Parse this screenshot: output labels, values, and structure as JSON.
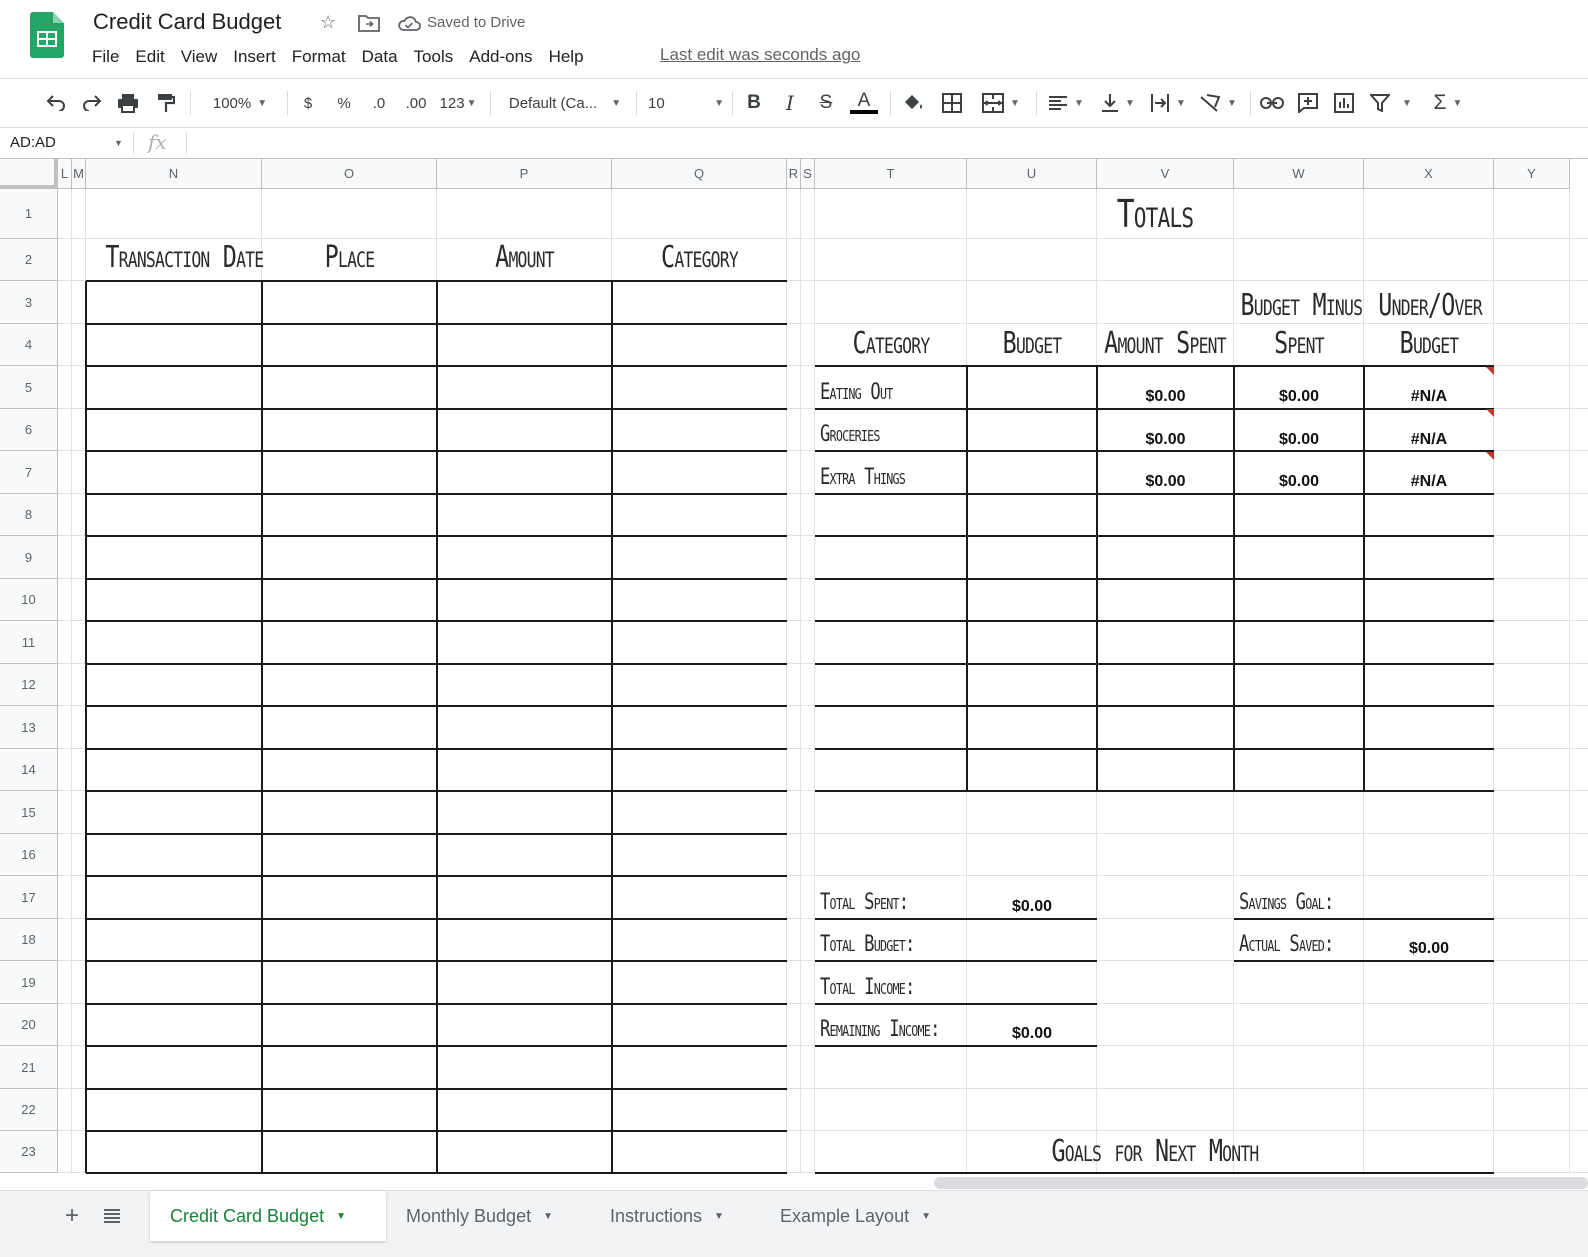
{
  "app": {
    "title": "Credit Card Budget",
    "saved_status": "Saved to Drive",
    "last_edit": "Last edit was seconds ago",
    "menu": [
      "File",
      "Edit",
      "View",
      "Insert",
      "Format",
      "Data",
      "Tools",
      "Add-ons",
      "Help"
    ]
  },
  "toolbar": {
    "zoom": "100%",
    "currency": "$",
    "percent": "%",
    "dec_decrease": ".0",
    "dec_increase": ".00",
    "more_formats": "123",
    "font": "Default (Ca...",
    "font_size": "10",
    "bold": "B",
    "italic": "I",
    "strike": "S",
    "text_color": "A",
    "sum": "Σ"
  },
  "formula_bar": {
    "name_box": "AD:AD",
    "fx": "fx"
  },
  "columns": [
    "L",
    "M",
    "N",
    "O",
    "P",
    "Q",
    "R",
    "S",
    "T",
    "U",
    "V",
    "W",
    "X",
    "Y"
  ],
  "rows": [
    "1",
    "2",
    "3",
    "4",
    "5",
    "6",
    "7",
    "8",
    "9",
    "10",
    "11",
    "12",
    "13",
    "14",
    "15",
    "16",
    "17",
    "18",
    "19",
    "20",
    "21",
    "22",
    "23"
  ],
  "transactions": {
    "headers": [
      "Transaction Date",
      "Place",
      "Amount",
      "Category"
    ]
  },
  "totals": {
    "title": "Totals",
    "headers": {
      "category": "Category",
      "budget": "Budget",
      "amount_spent": "Amount Spent",
      "budget_minus_l1": "Budget Minus",
      "budget_minus_l2": "Spent",
      "under_over_l1": "Under/Over",
      "under_over_l2": "Budget"
    },
    "rows": [
      {
        "category": "Eating Out",
        "spent": "$0.00",
        "minus": "$0.00",
        "under_over": "#N/A"
      },
      {
        "category": "Groceries",
        "spent": "$0.00",
        "minus": "$0.00",
        "under_over": "#N/A"
      },
      {
        "category": "Extra Things",
        "spent": "$0.00",
        "minus": "$0.00",
        "under_over": "#N/A"
      }
    ],
    "summary": {
      "total_spent_label": "Total Spent:",
      "total_spent": "$0.00",
      "total_budget_label": "Total Budget:",
      "total_income_label": "Total Income:",
      "remaining_income_label": "Remaining Income:",
      "remaining_income": "$0.00",
      "savings_goal_label": "Savings Goal:",
      "actual_saved_label": "Actual Saved:",
      "actual_saved": "$0.00"
    },
    "goals_title": "Goals for Next Month"
  },
  "sheets": [
    "Credit Card Budget",
    "Monthly Budget",
    "Instructions",
    "Example Layout"
  ]
}
